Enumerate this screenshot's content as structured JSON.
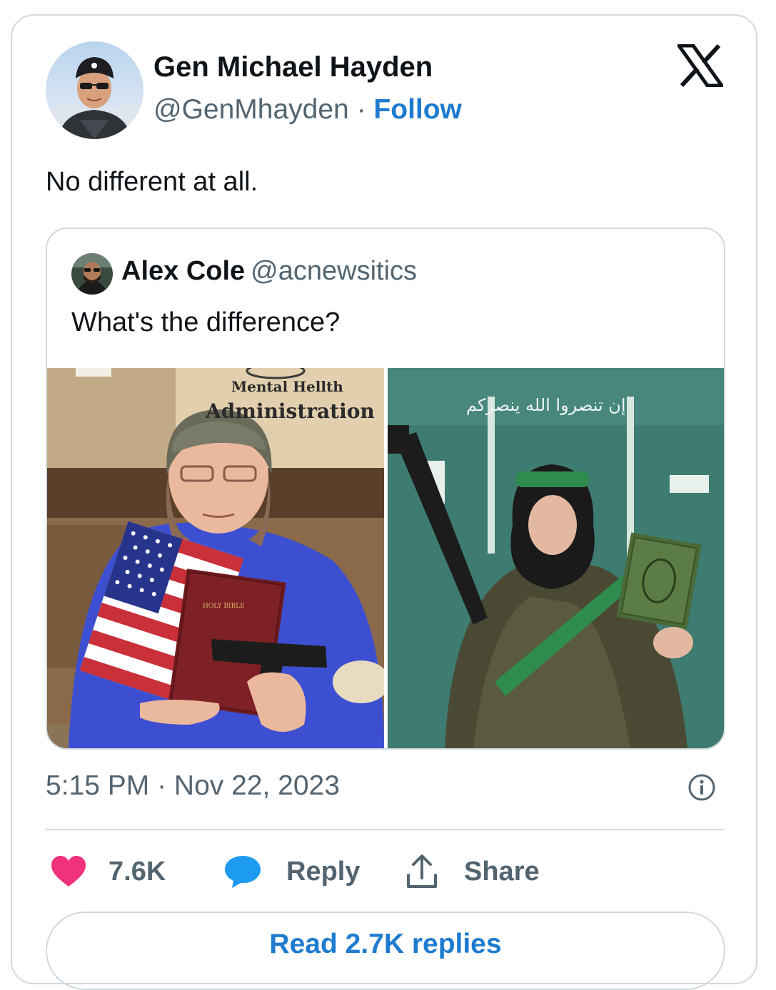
{
  "colors": {
    "link_blue": "#1d7bd0",
    "secondary_text": "#536471",
    "border": "#cfd9de",
    "heart_pink": "#f0317c",
    "reply_blue": "#1d9bf0"
  },
  "tweet": {
    "author": {
      "name": "Gen Michael Hayden",
      "handle": "@GenMhayden",
      "separator": " · ",
      "follow_label": "Follow",
      "avatar_icon": "profile-photo"
    },
    "platform_icon": "x-logo-icon",
    "text": "No different at all.",
    "quoted": {
      "name": "Alex Cole",
      "handle": "@acnewsitics",
      "text": "What's the difference?",
      "media": {
        "left": {
          "sign_line1": "Mental Hellth",
          "sign_line2": "Administration",
          "book_label": "HOLY BIBLE"
        },
        "right": {
          "banner_text": "إن تنصروا الله ينصركم"
        }
      }
    },
    "timestamp": "5:15 PM · Nov 22, 2023",
    "info_icon": "info-icon",
    "actions": {
      "like_count": "7.6K",
      "reply_label": "Reply",
      "share_label": "Share"
    },
    "read_replies_label": "Read 2.7K replies"
  }
}
